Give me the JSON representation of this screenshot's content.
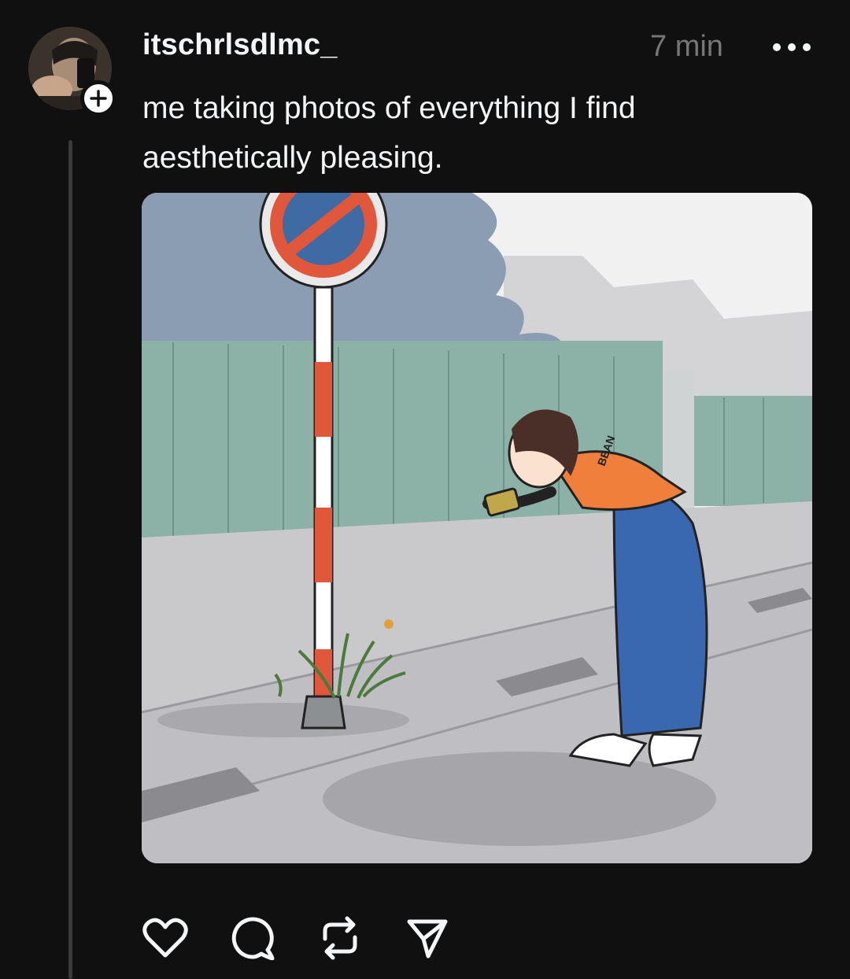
{
  "post": {
    "username": "itschrlsdlmc_",
    "timestamp": "7 min",
    "caption": "me taking photos of everything I find aesthetically pleasing."
  },
  "media": {
    "shirt_text": "BEAN"
  },
  "icons": {
    "more": "more-horizontal-icon",
    "follow": "plus-icon",
    "like": "heart-icon",
    "comment": "comment-icon",
    "repost": "repost-icon",
    "share": "send-icon"
  },
  "colors": {
    "background": "#101010",
    "text_primary": "#f3f5f7",
    "text_secondary": "#777777",
    "thread_line": "#3a3a3a"
  }
}
